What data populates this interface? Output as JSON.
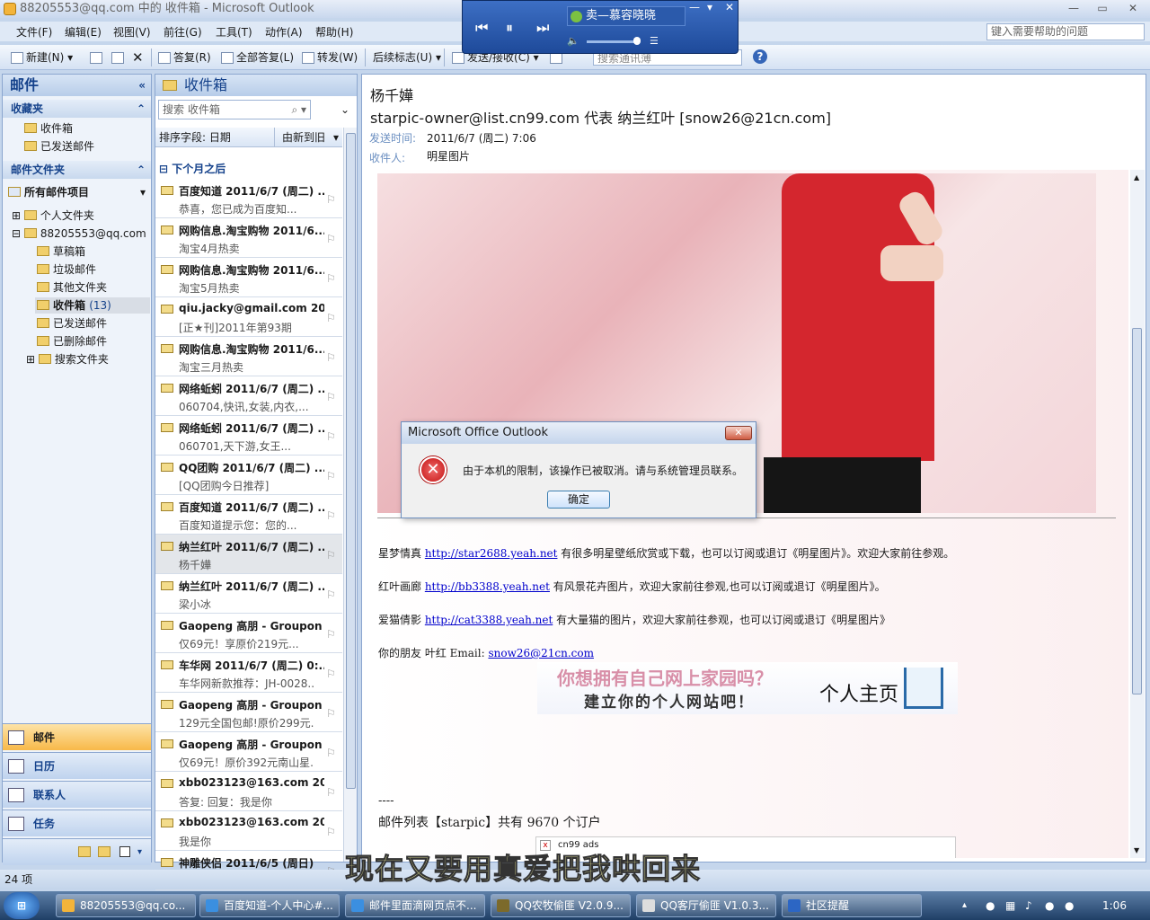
{
  "window": {
    "title": "88205553@qq.com 中的 收件箱 - Microsoft Outlook",
    "min": "—",
    "max": "▭",
    "close": "✕"
  },
  "menu": {
    "items": [
      "文件(F)",
      "编辑(E)",
      "视图(V)",
      "前往(G)",
      "工具(T)",
      "动作(A)",
      "帮助(H)"
    ],
    "help_placeholder": "键入需要帮助的问题"
  },
  "toolbar": {
    "new": "新建(N)",
    "reply": "答复(R)",
    "reply_all": "全部答复(L)",
    "forward": "转发(W)",
    "followup": "后续标志(U)",
    "send_recv": "发送/接收(C)",
    "search_addr": "搜索通讯薄"
  },
  "media": {
    "song": "卖—慕容晓晓",
    "prev": "⏮",
    "pause": "⏸",
    "next": "⏭",
    "min": "—",
    "menu": "▾",
    "close": "✕"
  },
  "nav": {
    "title": "邮件",
    "favorites_header": "收藏夹",
    "favorites": [
      "收件箱",
      "已发送邮件"
    ],
    "folders_header": "邮件文件夹",
    "all_items": "所有邮件项目",
    "personal": "个人文件夹",
    "account": "88205553@qq.com",
    "folders": [
      "草稿箱",
      "垃圾邮件",
      "其他文件夹",
      "收件箱",
      "已发送邮件",
      "已删除邮件",
      "搜索文件夹"
    ],
    "inbox_count": "(13)",
    "buttons": [
      "邮件",
      "日历",
      "联系人",
      "任务"
    ]
  },
  "list": {
    "title": "收件箱",
    "search_placeholder": "搜索 收件箱",
    "sort_label": "排序字段: 日期",
    "sort_order": "由新到旧",
    "group": "下个月之后",
    "items": [
      {
        "from": "百度知道 2011/6/7 (周二) ...",
        "subject": "恭喜，您已成为百度知..."
      },
      {
        "from": "网购信息.淘宝购物  2011/6...",
        "subject": "淘宝4月热卖"
      },
      {
        "from": "网购信息.淘宝购物  2011/6...",
        "subject": "淘宝5月热卖"
      },
      {
        "from": "qiu.jacky@gmail.com 20...",
        "subject": "[正★刊]2011年第93期"
      },
      {
        "from": "网购信息.淘宝购物  2011/6...",
        "subject": "淘宝三月热卖"
      },
      {
        "from": "网络蚯蚓 2011/6/7 (周二) ...",
        "subject": "060704,快讯,女装,内衣,..."
      },
      {
        "from": "网络蚯蚓 2011/6/7 (周二) ...",
        "subject": "060701,天下游,女王..."
      },
      {
        "from": "QQ团购  2011/6/7 (周二) ...",
        "subject": "[QQ团购今日推荐]"
      },
      {
        "from": "百度知道 2011/6/7 (周二) ...",
        "subject": "百度知道提示您：您的..."
      },
      {
        "from": "纳兰红叶 2011/6/7 (周二) ...",
        "subject": "杨千嬅"
      },
      {
        "from": "纳兰红叶 2011/6/7 (周二) ...",
        "subject": "梁小冰"
      },
      {
        "from": "Gaopeng 高朋 - Groupon .",
        "subject": "仅69元！享原价219元..."
      },
      {
        "from": "车华网 2011/6/7 (周二) 0:...",
        "subject": "车华网新款推荐：JH-0028..."
      },
      {
        "from": "Gaopeng 高朋 - Groupon .",
        "subject": "129元全国包邮!原价299元..."
      },
      {
        "from": "Gaopeng 高朋 - Groupon .",
        "subject": "仅69元！原价392元南山星..."
      },
      {
        "from": "xbb023123@163.com   20...",
        "subject": "答复: 回复：我是你"
      },
      {
        "from": "xbb023123@163.com   20...",
        "subject": "我是你"
      },
      {
        "from": "神雕侠侣  2011/6/5 (周日)",
        "subject": ""
      }
    ]
  },
  "reading": {
    "subject": "杨千嬅",
    "from": "starpic-owner@list.cn99.com 代表 纳兰红叶 [snow26@21cn.com]",
    "sent_label": "发送时间:",
    "sent_value": "2011/6/7 (周二) 7:06",
    "to_label": "收件人:",
    "to_value": "明星图片",
    "lines": [
      {
        "prefix": "星梦情真 ",
        "link": "http://star2688.yeah.net",
        "suffix": "  有很多明星壁纸欣赏或下载，也可以订阅或退订《明星图片》。欢迎大家前往参观。"
      },
      {
        "prefix": "红叶画廊 ",
        "link": "http://bb3388.yeah.net",
        "suffix": "  有风景花卉图片，欢迎大家前往参观,也可以订阅或退订《明星图片》。"
      },
      {
        "prefix": "爱猫倩影  ",
        "link": "http://cat3388.yeah.net",
        "suffix": "  有大量猫的图片，欢迎大家前往参观，也可以订阅或退订《明星图片》"
      },
      {
        "prefix": "你的朋友 叶红 Email: ",
        "link": "snow26@21cn.com",
        "suffix": ""
      }
    ],
    "banner_line1": "你想拥有自己网上家园吗？",
    "banner_line2": "建立你的个人网站吧！",
    "banner_brand": "个人主页",
    "dash": "----",
    "footer": "邮件列表【starpic】共有 9670 个订户",
    "ads": "cn99 ads"
  },
  "dialog": {
    "title": "Microsoft Office Outlook",
    "message": "由于本机的限制，该操作已被取消。请与系统管理员联系。",
    "ok": "确定",
    "close": "✕"
  },
  "status": {
    "count": "24 项"
  },
  "subtitle": "现在又要用真爱把我哄回来",
  "taskbar": {
    "tasks": [
      "88205553@qq.co...",
      "百度知道-个人中心#...",
      "邮件里面滴网页点不...",
      "QQ农牧偷匪 V2.0.9...",
      "QQ客厅偷匪 V1.0.3...",
      "社区提醒"
    ],
    "clock": "1:06"
  }
}
